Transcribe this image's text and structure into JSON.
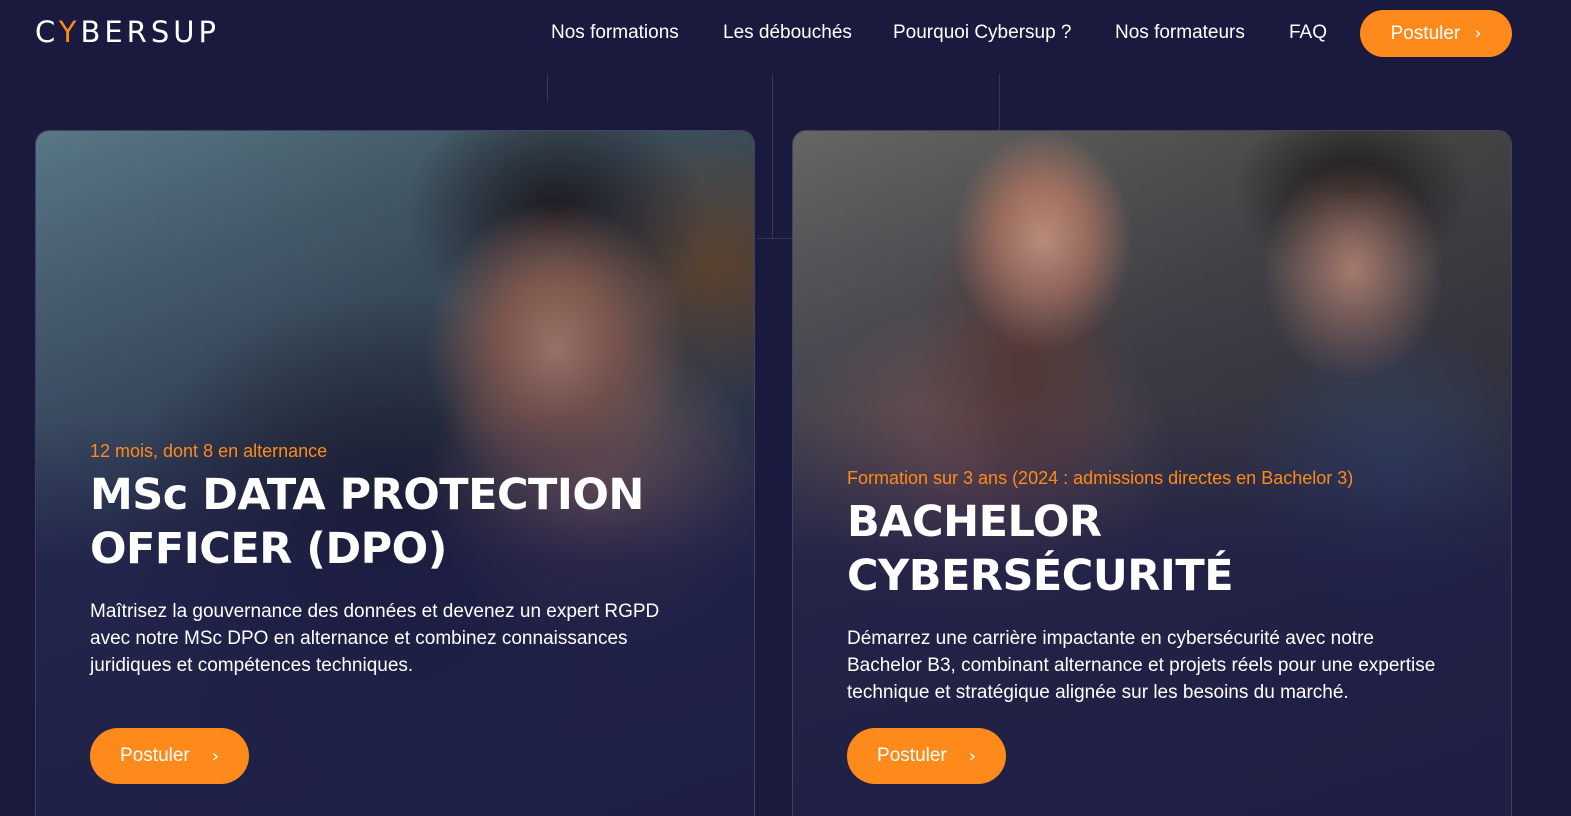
{
  "header": {
    "logo_before": "C",
    "logo_dot": "Y",
    "logo_after": "BERSUP",
    "nav": [
      {
        "label": "Nos formations"
      },
      {
        "label": "Les débouchés"
      },
      {
        "label": "Pourquoi Cybersup ?"
      },
      {
        "label": "Nos formateurs"
      },
      {
        "label": "FAQ"
      }
    ],
    "cta_label": "Postuler",
    "cta_icon": "chevron-right-icon"
  },
  "cards": [
    {
      "subtitle": "12 mois, dont 8 en alternance",
      "title": "MSc DATA PROTECTION OFFICER (DPO)",
      "description": "Maîtrisez la gouvernance des données et devenez un expert RGPD avec notre MSc DPO en alternance et combinez connaissances juridiques et compétences techniques.",
      "button_label": "Postuler"
    },
    {
      "subtitle": "Formation sur 3 ans (2024 : admissions directes en Bachelor 3)",
      "title": "BACHELOR CYBERSÉCURITÉ",
      "description": "Démarrez une carrière impactante en cybersécurité avec notre Bachelor B3, combinant alternance et projets réels pour une expertise technique et stratégique alignée sur les besoins du marché.",
      "button_label": "Postuler"
    }
  ],
  "colors": {
    "background": "#1a1a3e",
    "accent": "#ff8a1c"
  }
}
